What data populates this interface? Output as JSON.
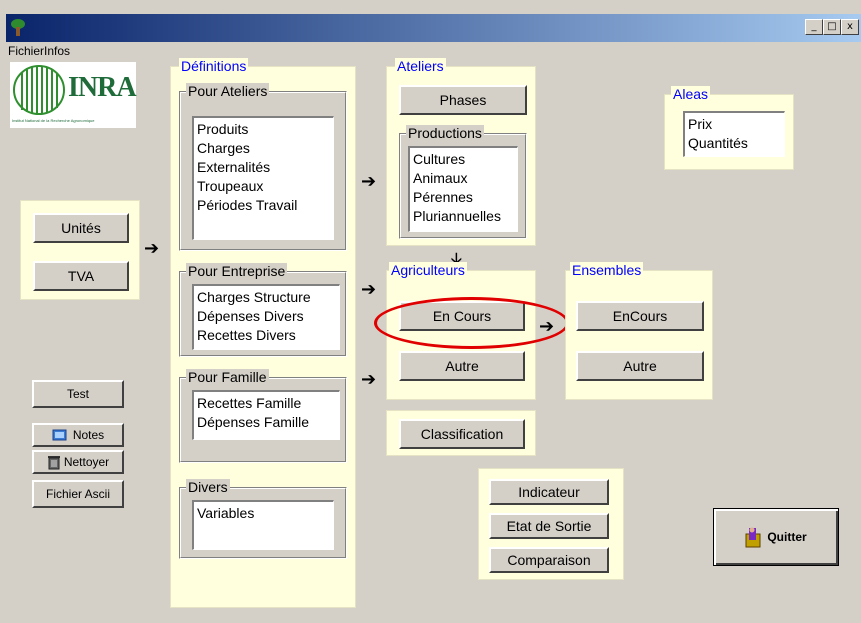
{
  "window": {
    "minimize": "_",
    "maximize": "□",
    "close": "x"
  },
  "menu": {
    "fichier": "Fichier",
    "infos": "Infos"
  },
  "logo": {
    "text": "INRA",
    "caption": "Institut National de la Recherche Agronomique"
  },
  "left": {
    "unites": "Unités",
    "tva": "TVA",
    "test": "Test",
    "notes": "Notes",
    "nettoyer": "Nettoyer",
    "fichier_ascii": "Fichier Ascii"
  },
  "definitions": {
    "title": "Définitions",
    "pour_ateliers": {
      "title": "Pour Ateliers",
      "items": [
        "Produits",
        "Charges",
        "Externalités",
        "Troupeaux",
        "Périodes Travail"
      ]
    },
    "pour_entreprise": {
      "title": "Pour Entreprise",
      "items": [
        "Charges Structure",
        "Dépenses Divers",
        "Recettes Divers"
      ]
    },
    "pour_famille": {
      "title": "Pour Famille",
      "items": [
        "Recettes Famille",
        "Dépenses Famille"
      ]
    },
    "divers": {
      "title": "Divers",
      "items": [
        "Variables"
      ]
    }
  },
  "ateliers": {
    "title": "Ateliers",
    "phases": "Phases",
    "productions": {
      "title": "Productions",
      "items": [
        "Cultures",
        "Animaux",
        "Pérennes",
        "Pluriannuelles"
      ]
    }
  },
  "agriculteurs": {
    "title": "Agriculteurs",
    "en_cours": "En Cours",
    "autre": "Autre"
  },
  "ensembles": {
    "title": "Ensembles",
    "en_cours": "EnCours",
    "autre": "Autre"
  },
  "classification": "Classification",
  "outputs": {
    "indicateur": "Indicateur",
    "etat_sortie": "Etat de Sortie",
    "comparaison": "Comparaison"
  },
  "aleas": {
    "title": "Aleas",
    "items": [
      "Prix",
      "Quantités"
    ]
  },
  "quitter": "Quitter",
  "arrows": {
    "right": "➔",
    "down": "🡣"
  },
  "colors": {
    "panel": "#ffffdd",
    "legend_blue": "#0000ff",
    "highlight": "#e00000",
    "titlebar_start": "#0a246a",
    "titlebar_end": "#a6caf0"
  }
}
